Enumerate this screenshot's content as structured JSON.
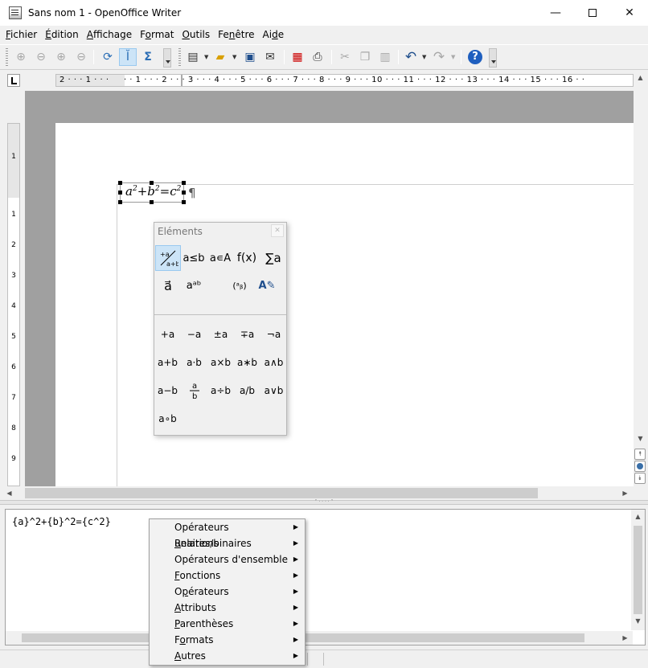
{
  "window": {
    "title": "Sans nom 1 - OpenOffice Writer",
    "minimize": "—",
    "close": "✕"
  },
  "menubar": [
    {
      "pre": "",
      "key": "F",
      "post": "ichier"
    },
    {
      "pre": "",
      "key": "É",
      "post": "dition"
    },
    {
      "pre": "",
      "key": "A",
      "post": "ffichage"
    },
    {
      "pre": "F",
      "key": "o",
      "post": "rmat"
    },
    {
      "pre": "",
      "key": "O",
      "post": "utils"
    },
    {
      "pre": "Fe",
      "key": "n",
      "post": "être"
    },
    {
      "pre": "Ai",
      "key": "d",
      "post": "e"
    }
  ],
  "toolbar": {
    "zoom_in": "⊕",
    "zoom_out": "⊖",
    "zoom_100": "⊕",
    "zoom_page": "⊖",
    "update": "⟳",
    "formula_cursor": "Ĭ",
    "symbols": "Σ",
    "new": "▤",
    "open": "▰",
    "save": "▣",
    "email": "✉",
    "pdf": "▦",
    "print": "⎙",
    "cut": "✂",
    "copy": "❐",
    "paste": "▥",
    "undo": "↶",
    "redo": "↷",
    "help": "?"
  },
  "hruler": "2 · · · 1 · · ·     · · 1 · · · 2 · · · 3 · · · 4 · · · 5 · · · 6 · · · 7 · · · 8 · · · 9 · · · 10 · · · 11 · · · 12 · · · 13 · · · 14 · · · 15 · · · 16 · ·",
  "vruler": [
    "1",
    "1",
    "2",
    "3",
    "4",
    "5",
    "6",
    "7",
    "8",
    "9"
  ],
  "document": {
    "formula": {
      "a": "a",
      "b": "b",
      "c": "c",
      "exp": "2",
      "plus": "+",
      "eq": "="
    },
    "pilcrow": "¶"
  },
  "command": {
    "text": "{a}^2+{b}^2={c^2}"
  },
  "elements": {
    "title": "Eléments",
    "close": "✕",
    "categories": [
      {
        "label": "+a/a+b"
      },
      {
        "label": "a≤b"
      },
      {
        "label": "a∊A"
      },
      {
        "label": "f(x)"
      },
      {
        "label": "∑a"
      },
      {
        "label": "a⃗"
      },
      {
        "label": "aᵃᵇ"
      },
      {
        "label": "(ᵃᵦ)"
      },
      {
        "label": "A✎"
      }
    ],
    "operators": [
      "+a",
      "−a",
      "±a",
      "∓a",
      "¬a",
      "a+b",
      "a·b",
      "a×b",
      "a∗b",
      "a∧b",
      "a−b",
      "a/b frac",
      "a÷b",
      "a/b",
      "a∨b",
      "a∘b"
    ]
  },
  "context_menu": [
    {
      "pre": "Opérateurs ",
      "key": "u",
      "post": "naires/binaires"
    },
    {
      "pre": "",
      "key": "R",
      "post": "elations"
    },
    {
      "pre": "Opérateurs d'ensemble",
      "key": "",
      "post": ""
    },
    {
      "pre": "",
      "key": "F",
      "post": "onctions"
    },
    {
      "pre": "O",
      "key": "p",
      "post": "érateurs"
    },
    {
      "pre": "",
      "key": "A",
      "post": "ttributs"
    },
    {
      "pre": "",
      "key": "P",
      "post": "arenthèses"
    },
    {
      "pre": "F",
      "key": "o",
      "post": "rmats"
    },
    {
      "pre": "",
      "key": "A",
      "post": "utres"
    }
  ],
  "colors": {
    "accent": "#cce4f7",
    "accent_border": "#99c9ef",
    "doc_bg": "#a0a0a0"
  }
}
